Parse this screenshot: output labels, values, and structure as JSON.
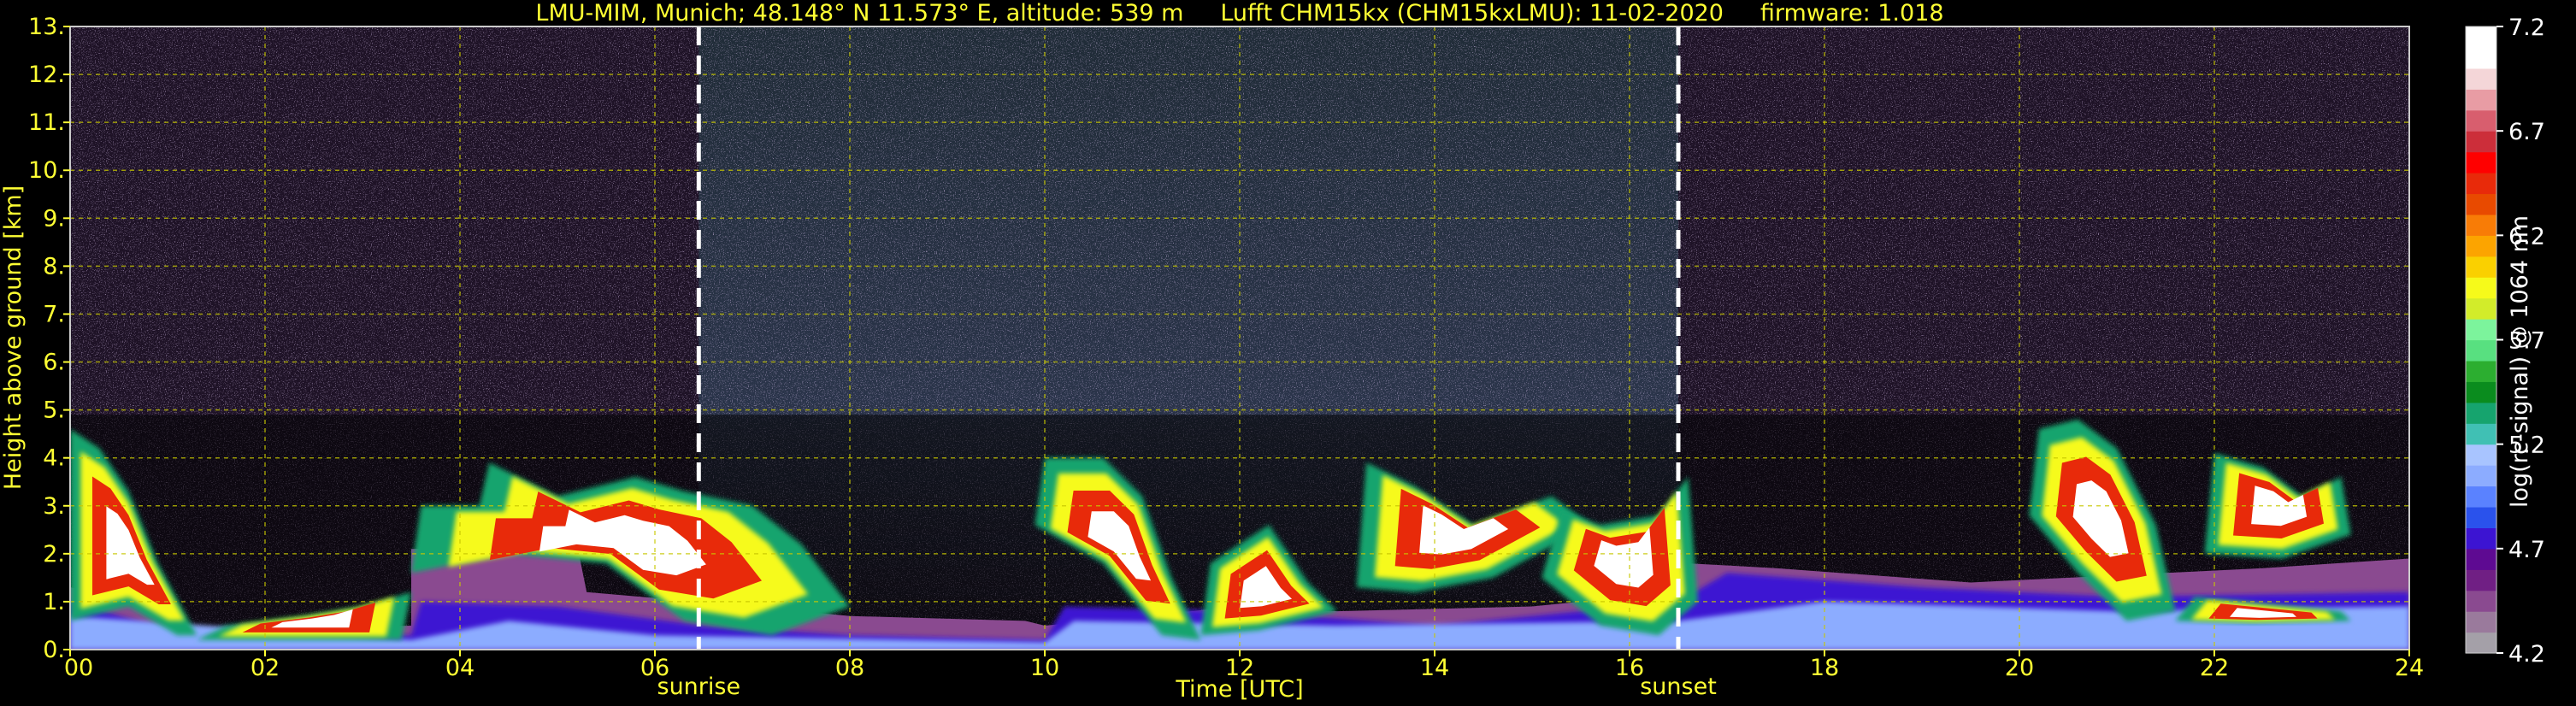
{
  "chart_data": {
    "type": "heatmap",
    "title": "LMU-MIM, Munich; 48.148° N 11.573° E, altitude: 539 m     Lufft CHM15kx (CHM15kxLMU): 11-02-2020     firmware: 1.018",
    "xlabel": "Time [UTC]",
    "ylabel": "Height above ground [km]",
    "colorbar_label": "log(rc-signal) @ 1064 nm",
    "xlim": [
      0,
      24
    ],
    "ylim": [
      0,
      13
    ],
    "x_ticks": [
      "00",
      "02",
      "04",
      "06",
      "08",
      "10",
      "12",
      "14",
      "16",
      "18",
      "20",
      "22",
      "24"
    ],
    "y_ticks": [
      "0.",
      "1.",
      "2.",
      "3.",
      "4.",
      "5.",
      "6.",
      "7.",
      "8.",
      "9.",
      "10.",
      "11.",
      "12.",
      "13."
    ],
    "colorbar_ticks": [
      "4.2",
      "4.7",
      "5.2",
      "5.7",
      "6.2",
      "6.7",
      "7.2"
    ],
    "colorbar_range": [
      4.2,
      7.2
    ],
    "grid": true,
    "annotations": [
      {
        "label": "sunrise",
        "time": 6.45
      },
      {
        "label": "sunset",
        "time": 16.5
      }
    ],
    "colors": {
      "background": "#000000",
      "label": "#ffff33",
      "grid": "#c8c800",
      "colorbar_stops": [
        "#a4a0a8",
        "#9a7a9c",
        "#8a4a90",
        "#701f84",
        "#5e0a92",
        "#3c14d2",
        "#2a52ec",
        "#5a82ff",
        "#8cacff",
        "#a8c4ff",
        "#40c0b4",
        "#16a46e",
        "#0a8c1e",
        "#2cae30",
        "#58e080",
        "#7cf49c",
        "#d2ec2a",
        "#f6fa1a",
        "#fad000",
        "#fca400",
        "#f87c06",
        "#e84a00",
        "#e82a0a",
        "#ff0000",
        "#cc2e3a",
        "#d85e6e",
        "#e89ca4",
        "#f4d6d8",
        "#ffffff",
        "#ffffff"
      ]
    }
  }
}
